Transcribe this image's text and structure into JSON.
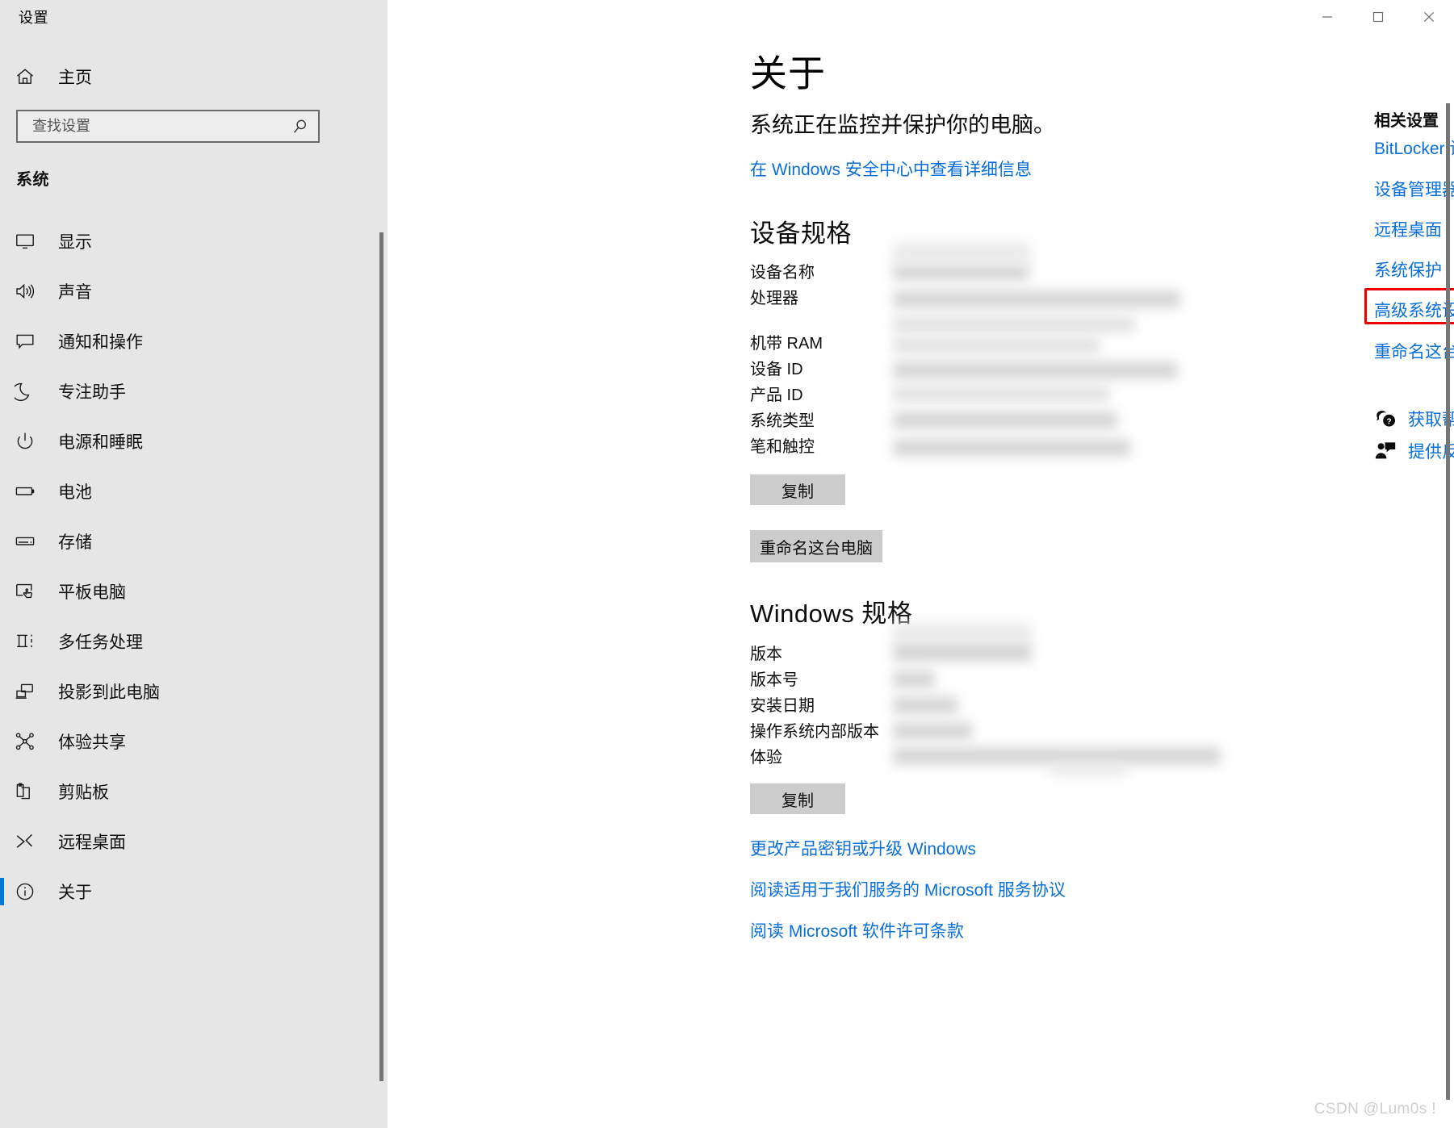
{
  "window": {
    "app_title": "设置",
    "controls": {
      "minimize": "minimize-icon",
      "maximize": "maximize-icon",
      "close": "close-icon"
    }
  },
  "sidebar": {
    "home_label": "主页",
    "home_icon": "home-icon",
    "search": {
      "placeholder": "查找设置",
      "value": "",
      "icon": "search-icon"
    },
    "category_heading": "系统",
    "items": [
      {
        "label": "显示",
        "icon": "monitor-icon",
        "selected": false
      },
      {
        "label": "声音",
        "icon": "speaker-icon",
        "selected": false
      },
      {
        "label": "通知和操作",
        "icon": "notification-icon",
        "selected": false
      },
      {
        "label": "专注助手",
        "icon": "moon-icon",
        "selected": false
      },
      {
        "label": "电源和睡眠",
        "icon": "power-icon",
        "selected": false
      },
      {
        "label": "电池",
        "icon": "battery-icon",
        "selected": false
      },
      {
        "label": "存储",
        "icon": "storage-icon",
        "selected": false
      },
      {
        "label": "平板电脑",
        "icon": "tablet-icon",
        "selected": false
      },
      {
        "label": "多任务处理",
        "icon": "multitasking-icon",
        "selected": false
      },
      {
        "label": "投影到此电脑",
        "icon": "project-icon",
        "selected": false
      },
      {
        "label": "体验共享",
        "icon": "share-icon",
        "selected": false
      },
      {
        "label": "剪贴板",
        "icon": "clipboard-icon",
        "selected": false
      },
      {
        "label": "远程桌面",
        "icon": "remote-desktop-icon",
        "selected": false
      },
      {
        "label": "关于",
        "icon": "info-icon",
        "selected": true
      }
    ]
  },
  "main": {
    "page_title": "关于",
    "subtitle": "系统正在监控并保护你的电脑。",
    "security_link": "在 Windows 安全中心中查看详细信息",
    "device_spec": {
      "heading": "设备规格",
      "rows": [
        {
          "label": "设备名称",
          "value": ""
        },
        {
          "label": "处理器",
          "value": ""
        },
        {
          "label": "机带 RAM",
          "value": ""
        },
        {
          "label": "设备 ID",
          "value": ""
        },
        {
          "label": "产品 ID",
          "value": ""
        },
        {
          "label": "系统类型",
          "value": ""
        },
        {
          "label": "笔和触控",
          "value": ""
        }
      ],
      "copy_button": "复制",
      "rename_button": "重命名这台电脑"
    },
    "windows_spec": {
      "heading": "Windows 规格",
      "rows": [
        {
          "label": "版本",
          "value": ""
        },
        {
          "label": "版本号",
          "value": ""
        },
        {
          "label": "安装日期",
          "value": ""
        },
        {
          "label": "操作系统内部版本",
          "value": ""
        },
        {
          "label": "体验",
          "value": ""
        }
      ],
      "copy_button": "复制"
    },
    "bottom_links": [
      "更改产品密钥或升级 Windows",
      "阅读适用于我们服务的 Microsoft 服务协议",
      "阅读 Microsoft 软件许可条款"
    ]
  },
  "related": {
    "heading": "相关设置",
    "links": [
      "BitLocker 设置",
      "设备管理器",
      "远程桌面",
      "系统保护",
      "高级系统设置",
      "重命名这台电脑"
    ],
    "highlighted_link": "高级系统设置",
    "highlight_color": "#ee0000",
    "actions": [
      {
        "label": "获取帮助",
        "icon": "help-question-icon"
      },
      {
        "label": "提供反馈",
        "icon": "feedback-person-icon"
      }
    ]
  },
  "accent_color": "#0078d7",
  "link_color": "#0a6fd8",
  "watermark": "CSDN @Lum0s !"
}
